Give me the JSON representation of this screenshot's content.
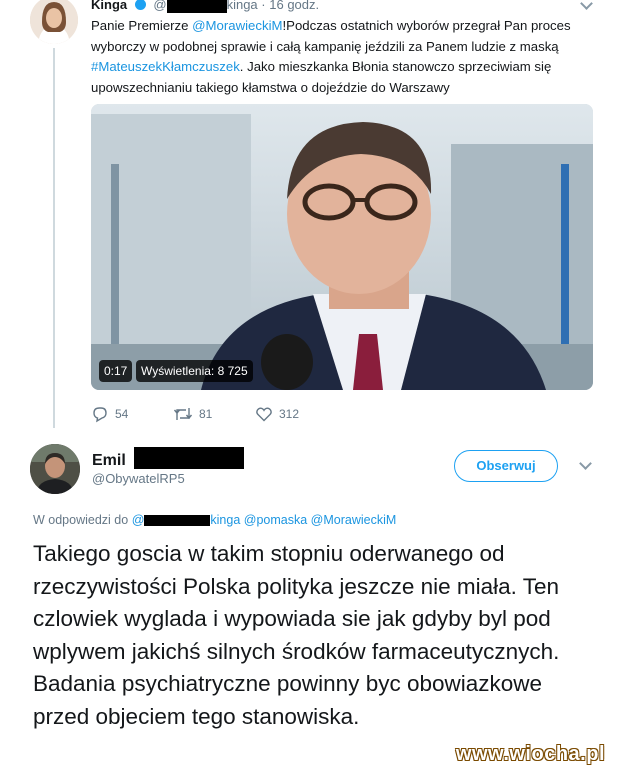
{
  "tweet1": {
    "author_name": "Kinga",
    "handle_at": "@",
    "handle_suffix": "kinga",
    "separator": "·",
    "time": "16 godz.",
    "text": {
      "p1": "Panie Premierze ",
      "mention": "@MorawieckiM",
      "p2": "!Podczas ostatnich wyborów przegrał Pan proces wyborczy w podobnej sprawie i całą kampanię jeździli za Panem ludzie z maską ",
      "hashtag": "#MateuszekKłamczuszek",
      "p3": ". Jako mieszkanka Błonia stanowczo sprzeciwiam się upowszechnianiu takiego kłamstwa o dojeździe do Warszawy"
    },
    "video": {
      "duration": "0:17",
      "views": "Wyświetlenia: 8 725"
    },
    "actions": {
      "replies": "54",
      "retweets": "81",
      "likes": "312"
    }
  },
  "tweet2": {
    "author_name": "Emil",
    "handle": "@ObywatelRP5",
    "follow_label": "Obserwuj",
    "reply_prefix": "W odpowiedzi do",
    "reply_mentions": {
      "m1_at": "@",
      "m1_suffix": "kinga",
      "m2": "@pomaska",
      "m3": "@MorawieckiM"
    },
    "text": "Takiego goscia w takim stopniu oderwanego od rzeczywistości Polska polityka jeszcze nie miała. Ten czlowiek wyglada i wypowiada sie jak gdyby byl pod wplywem jakichś silnych środków farmaceutycznych. Badania psychiatryczne powinny byc obowiazkowe przed objeciem tego stanowiska."
  },
  "watermark": "www.wiocha.pl",
  "colors": {
    "link": "#1b95e0",
    "accent": "#1da1f2",
    "muted": "#657786",
    "text": "#14171a"
  },
  "icons": [
    "reply-icon",
    "retweet-icon",
    "like-icon",
    "chevron-down-icon",
    "verified-badge-icon"
  ]
}
